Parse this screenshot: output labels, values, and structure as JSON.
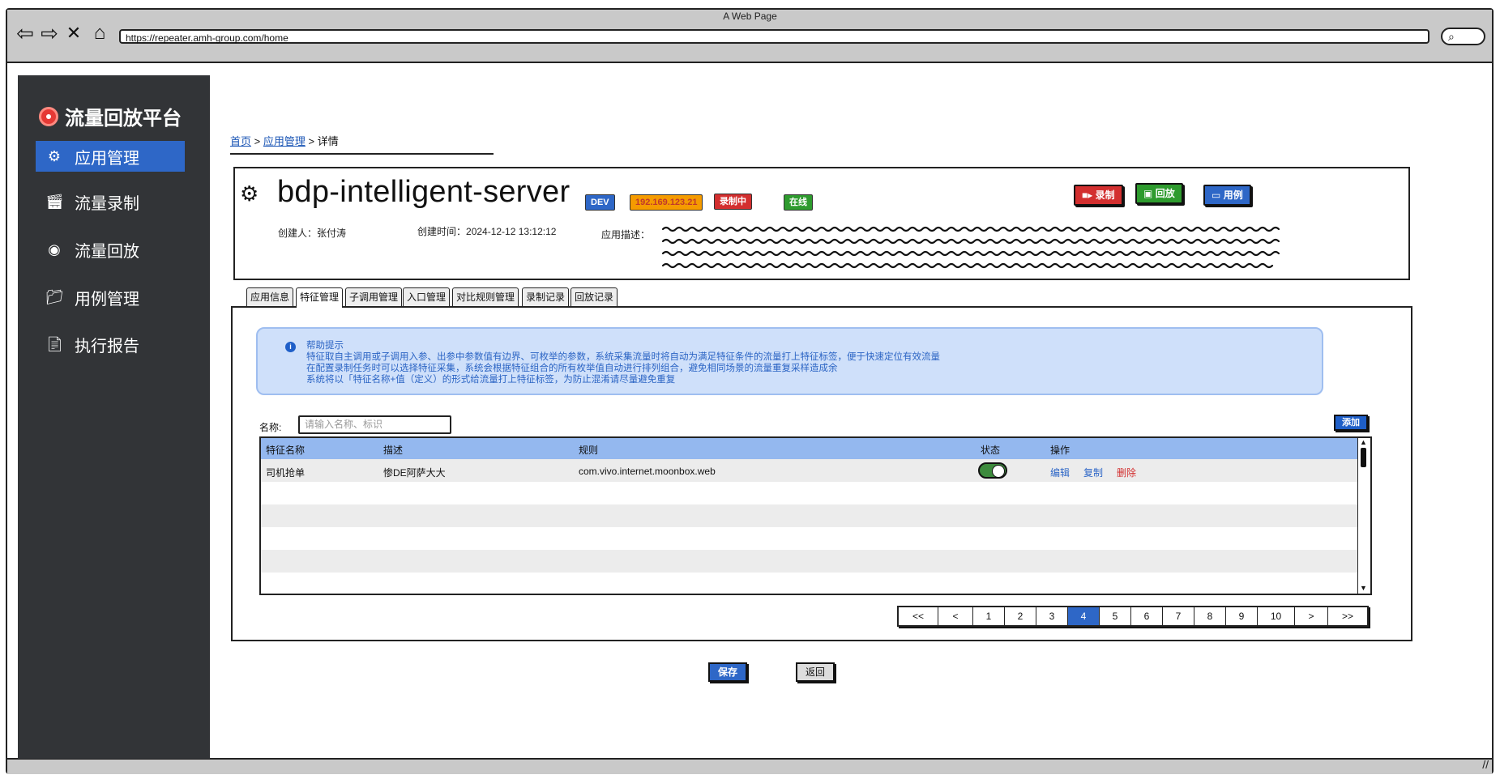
{
  "window": {
    "title": "A Web Page",
    "url": "https://repeater.amh-group.com/home"
  },
  "brand": {
    "name": "流量回放平台"
  },
  "sidebar": {
    "items": [
      {
        "label": "应用管理",
        "icon": "gear-icon",
        "active": true
      },
      {
        "label": "流量录制",
        "icon": "clapper-icon",
        "active": false
      },
      {
        "label": "流量回放",
        "icon": "playback-icon",
        "active": false
      },
      {
        "label": "用例管理",
        "icon": "folder-icon",
        "active": false
      },
      {
        "label": "执行报告",
        "icon": "report-icon",
        "active": false
      }
    ]
  },
  "breadcrumb": {
    "home": "首页",
    "app_mgmt": "应用管理",
    "current": "详情",
    "sep": ">"
  },
  "app": {
    "name": "bdp-intelligent-server",
    "env_badge": "DEV",
    "ip_badge": "192.169.123.21",
    "recording_badge": "录制中",
    "online_badge": "在线",
    "creator_label": "创建人：",
    "creator": "张付涛",
    "created_label": "创建时间：",
    "created_at": "2024-12-12 13:12:12",
    "desc_label": "应用描述：",
    "actions": {
      "record": "录制",
      "replay": "回放",
      "case": "用例"
    }
  },
  "tabs": [
    "应用信息",
    "特征管理",
    "子调用管理",
    "入口管理",
    "对比规则管理",
    "录制记录",
    "回放记录"
  ],
  "active_tab": "特征管理",
  "help": {
    "title": "帮助提示",
    "lines": [
      "特征取自主调用或子调用入参、出参中参数值有边界、可枚举的参数，系统采集流量时将自动为满足特征条件的流量打上特征标签，便于快速定位有效流量",
      "在配置录制任务时可以选择特征采集，系统会根据特征组合的所有枚举值自动进行排列组合，避免相同场景的流量重复采样造成余",
      "系统将以「特征名称+值（定义）的形式给流量打上特征标签，为防止混淆请尽量避免重复"
    ]
  },
  "filter": {
    "name_label": "名称:",
    "name_placeholder": "请输入名称、标识",
    "add_label": "添加"
  },
  "table": {
    "columns": [
      "特征名称",
      "描述",
      "规则",
      "状态",
      "操作"
    ],
    "rows": [
      {
        "name": "司机抢单",
        "desc": "惨DE阿萨大大",
        "rule": "com.vivo.internet.moonbox.web",
        "enabled": true,
        "ops": [
          "编辑",
          "复制",
          "删除"
        ]
      }
    ]
  },
  "pagination": {
    "pages": [
      "<<",
      "<",
      "1",
      "2",
      "3",
      "4",
      "5",
      "6",
      "7",
      "8",
      "9",
      "10",
      ">",
      ">>"
    ],
    "current": "4"
  },
  "footer": {
    "save_label": "保存",
    "back_label": "返回"
  },
  "colors": {
    "sidebar_bg": "#323437",
    "accent": "#2e67c7",
    "danger": "#d32f2f",
    "success": "#2e9b2e",
    "warning": "#f59b00"
  }
}
